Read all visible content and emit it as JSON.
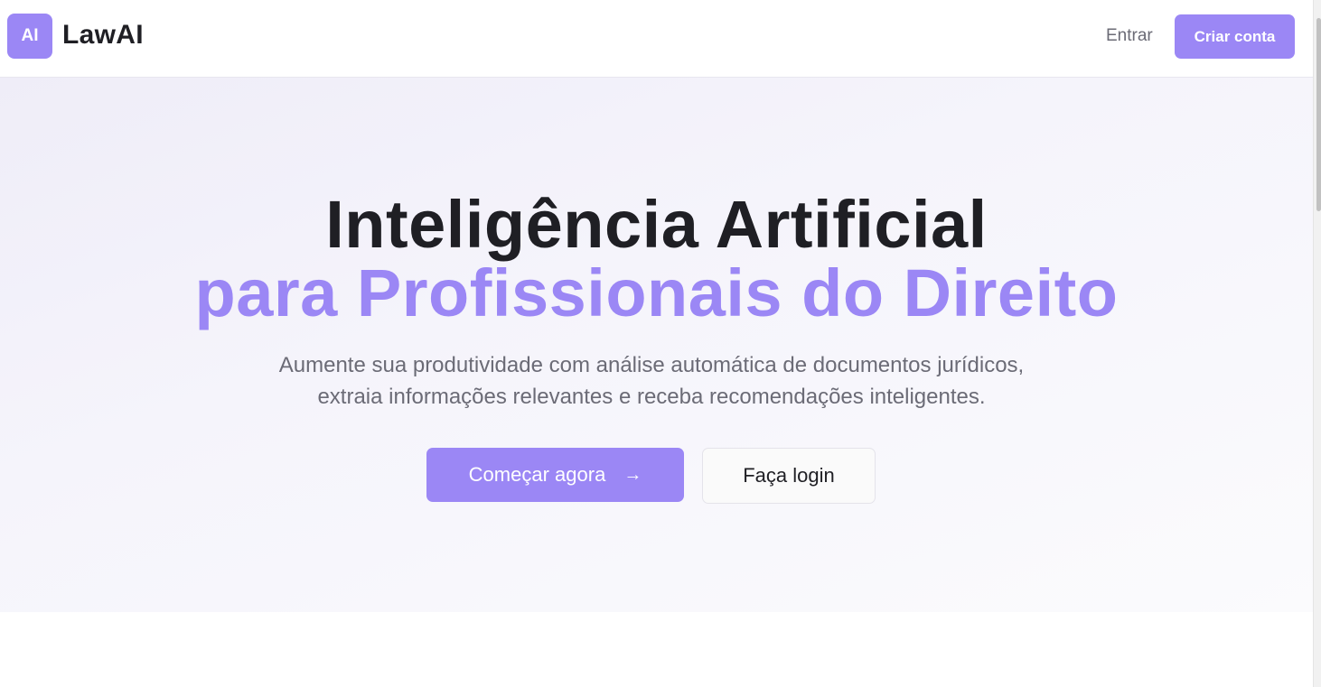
{
  "header": {
    "logo_badge": "AI",
    "brand": "LawAI",
    "login_label": "Entrar",
    "signup_label": "Criar conta"
  },
  "hero": {
    "title_line1": "Inteligência Artificial",
    "title_line2": "para Profissionais do Direito",
    "subtitle_line1": "Aumente sua produtividade com análise automática de documentos jurídicos,",
    "subtitle_line2": "extraia informações relevantes e receba recomendações inteligentes.",
    "primary_cta": "Começar agora",
    "secondary_cta": "Faça login"
  },
  "icons": {
    "arrow": "arrow-right-icon"
  },
  "colors": {
    "accent": "#9b87f5",
    "text_dark": "#1f1f24",
    "text_muted": "#6b6b76"
  }
}
